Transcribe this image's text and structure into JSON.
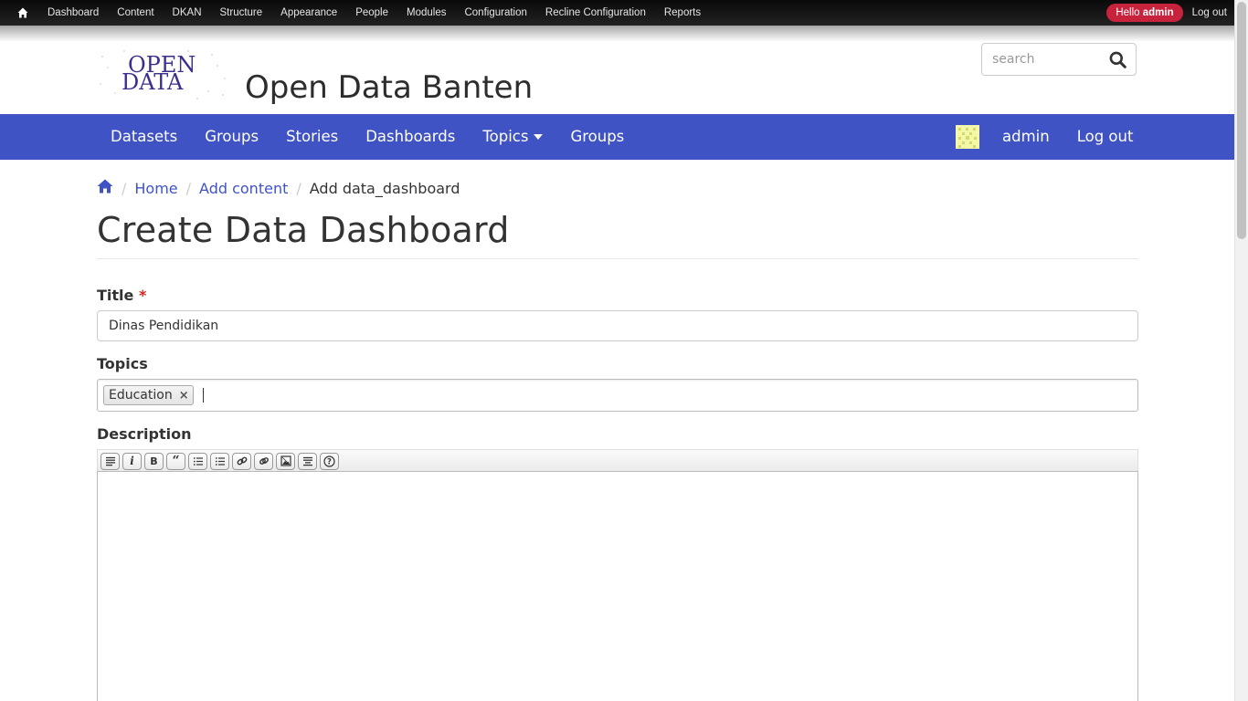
{
  "admin_bar": {
    "items": [
      "Dashboard",
      "Content",
      "DKAN",
      "Structure",
      "Appearance",
      "People",
      "Modules",
      "Configuration",
      "Recline Configuration",
      "Reports"
    ],
    "hello_prefix": "Hello",
    "hello_user": "admin",
    "logout": "Log out"
  },
  "header": {
    "logo_line1": "OPEN",
    "logo_line2": "DATA",
    "site_name": "Open Data Banten",
    "search_placeholder": "search"
  },
  "main_nav": {
    "items": [
      "Datasets",
      "Groups",
      "Stories",
      "Dashboards",
      "Topics",
      "Groups"
    ],
    "user": "admin",
    "logout": "Log out"
  },
  "breadcrumb": {
    "home": "Home",
    "add_content": "Add content",
    "current": "Add data_dashboard"
  },
  "page": {
    "title": "Create Data Dashboard"
  },
  "form": {
    "title_label": "Title",
    "required_mark": "*",
    "title_value": "Dinas Pendidikan",
    "topics_label": "Topics",
    "topic_chip": "Education",
    "chip_remove": "×",
    "description_label": "Description"
  },
  "editor_toolbar": [
    "format-icon",
    "italic-icon",
    "bold-icon",
    "blockquote-icon",
    "numbered-list-icon",
    "bulleted-list-icon",
    "unlink-icon",
    "link-icon",
    "image-icon",
    "align-icon",
    "help-icon"
  ],
  "colors": {
    "nav_blue": "#3f53c4",
    "hello_badge": "#c8233c",
    "required": "#d9261c"
  }
}
